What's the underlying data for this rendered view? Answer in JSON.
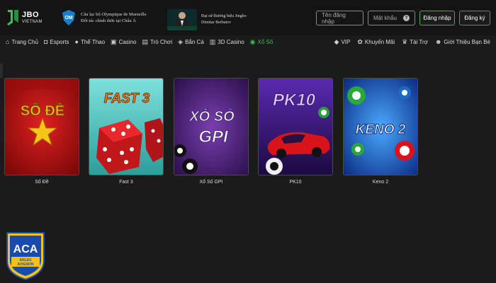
{
  "header": {
    "logo_main": "JBO",
    "logo_sub": "VIETNAM",
    "partner1_line1": "Câu lạc bộ Olympique de Marseille",
    "partner1_line2": "Đối tác chính thức tại Châu Á",
    "partner2_line1": "Đại sứ thương hiệu Jingbo",
    "partner2_line2": "Dimitar Berbatov",
    "username_placeholder": "Tên đăng nhập",
    "password_placeholder": "Mật khẩu",
    "login_label": "Đăng nhập",
    "register_label": "Đăng ký"
  },
  "nav": {
    "left": [
      {
        "label": "Trang Chủ",
        "icon": "home-icon"
      },
      {
        "label": "Esports",
        "icon": "gamepad-icon"
      },
      {
        "label": "Thể Thao",
        "icon": "soccer-ball-icon"
      },
      {
        "label": "Casino",
        "icon": "cards-icon"
      },
      {
        "label": "Trò Chơi",
        "icon": "slot-icon"
      },
      {
        "label": "Bắn Cá",
        "icon": "fish-icon"
      },
      {
        "label": "3D Casino",
        "icon": "3d-icon"
      },
      {
        "label": "Xổ Số",
        "icon": "lottery-icon",
        "active": true
      }
    ],
    "right": [
      {
        "label": "VIP",
        "icon": "diamond-icon"
      },
      {
        "label": "Khuyến Mãi",
        "icon": "gift-icon"
      },
      {
        "label": "Tài Trợ",
        "icon": "trophy-icon"
      },
      {
        "label": "Giới Thiệu Bạn Bè",
        "icon": "friends-icon"
      }
    ]
  },
  "games": [
    {
      "label": "Số Đề",
      "art_text": "SỐ ĐỀ"
    },
    {
      "label": "Fast 3",
      "art_text": "FAST 3"
    },
    {
      "label": "Xổ Số GPI",
      "art_text_1": "XỔ SỐ",
      "art_text_2": "GPI"
    },
    {
      "label": "PK10",
      "art_text": "PK10"
    },
    {
      "label": "Keno 2",
      "art_text": "KENO 2"
    }
  ],
  "badge": {
    "main": "ACA",
    "sub1": "ARLES",
    "sub2": "AVIGNON"
  },
  "colors": {
    "accent": "#3fbf55",
    "bg": "#1b1b1b",
    "header_bg": "#141414"
  }
}
